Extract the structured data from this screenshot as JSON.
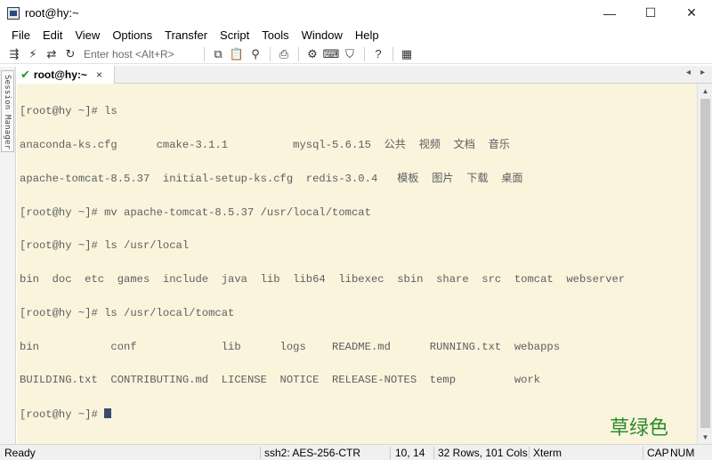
{
  "window": {
    "title": "root@hy:~",
    "controls": {
      "minimize": "—",
      "maximize": "☐",
      "close": "✕"
    }
  },
  "menu": [
    "File",
    "Edit",
    "View",
    "Options",
    "Transfer",
    "Script",
    "Tools",
    "Window",
    "Help"
  ],
  "toolbar": {
    "host_placeholder": "Enter host <Alt+R>",
    "icons_left": [
      "connect-icon",
      "quick-connect-icon",
      "reconnect-icon",
      "reconnect-all-icon"
    ],
    "icons_right": [
      "copy-icon",
      "paste-icon",
      "find-icon",
      "print-icon",
      "settings-icon",
      "keymap-icon",
      "sftp-icon",
      "help-icon",
      "map-icon"
    ]
  },
  "session_manager": {
    "label": "Session Manager"
  },
  "tab": {
    "label": "root@hy:~",
    "close": "×",
    "nav_left": "◂",
    "nav_right": "▸"
  },
  "terminal": {
    "lines": [
      "[root@hy ~]# ls",
      "anaconda-ks.cfg      cmake-3.1.1          mysql-5.6.15  公共  视频  文档  音乐",
      "apache-tomcat-8.5.37  initial-setup-ks.cfg  redis-3.0.4   模板  图片  下载  桌面",
      "[root@hy ~]# mv apache-tomcat-8.5.37 /usr/local/tomcat",
      "[root@hy ~]# ls /usr/local",
      "bin  doc  etc  games  include  java  lib  lib64  libexec  sbin  share  src  tomcat  webserver",
      "[root@hy ~]# ls /usr/local/tomcat",
      "bin           conf             lib      logs    README.md      RUNNING.txt  webapps",
      "BUILDING.txt  CONTRIBUTING.md  LICENSE  NOTICE  RELEASE-NOTES  temp         work"
    ],
    "prompt": "[root@hy ~]# ",
    "watermark": "草绿色"
  },
  "status": {
    "ready": "Ready",
    "protocol": "ssh2: AES-256-CTR",
    "cursor_pos": "10, 14",
    "size": "32 Rows, 101 Cols",
    "term_type": "Xterm",
    "caps": "CAP",
    "num": "NUM"
  },
  "colors": {
    "terminal_bg": "#fbf4dc",
    "terminal_fg": "#5c5e62",
    "watermark": "#2d8b2d",
    "tab_check": "#1a9a2a"
  }
}
